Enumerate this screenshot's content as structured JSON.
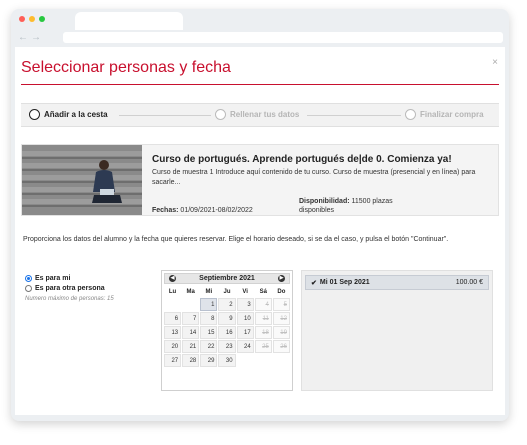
{
  "modal": {
    "title": "Seleccionar personas y fecha",
    "close": "×"
  },
  "steps": [
    {
      "label": "Añadir a la cesta",
      "state": "active"
    },
    {
      "label": "Rellenar tus datos",
      "state": "inactive"
    },
    {
      "label": "Finalizar compra",
      "state": "inactive"
    }
  ],
  "course": {
    "title": "Curso de portugués. Aprende portugués de|de 0. Comienza ya!",
    "description": "Curso de muestra 1  Introduce aquí contenido de tu curso. Curso de muestra (presencial y en línea) para sacarle...",
    "dates_label": "Fechas:",
    "dates_value": "01/09/2021-08/02/2022",
    "availability_label": "Disponibilidad:",
    "availability_value": "11500 plazas",
    "availability_value2": "disponibles"
  },
  "instructions": "Proporciona los datos del alumno y la fecha que quieres reservar. Elige el horario deseado, si se da el caso, y pulsa el botón \"Continuar\".",
  "booking": {
    "options": [
      {
        "label": "Es para mi",
        "checked": true
      },
      {
        "label": "Es para otra persona",
        "checked": false
      }
    ],
    "max_note": "Numero máximo de personas: 15"
  },
  "calendar": {
    "month": "Septiembre 2021",
    "prev_icon": "chevron-left-icon",
    "next_icon": "chevron-right-icon",
    "weekdays": [
      "Lu",
      "Ma",
      "Mi",
      "Ju",
      "Vi",
      "Sá",
      "Do"
    ],
    "weeks": [
      [
        "",
        "",
        "1",
        "2",
        "3",
        "4",
        "5"
      ],
      [
        "6",
        "7",
        "8",
        "9",
        "10",
        "11",
        "12"
      ],
      [
        "13",
        "14",
        "15",
        "16",
        "17",
        "18",
        "19"
      ],
      [
        "20",
        "21",
        "22",
        "23",
        "24",
        "25",
        "26"
      ],
      [
        "27",
        "28",
        "29",
        "30",
        "",
        "",
        ""
      ]
    ],
    "selected": "1"
  },
  "slots": [
    {
      "date": "Mi 01 Sep 2021",
      "price": "100.00 €",
      "selected": true
    }
  ],
  "colors": {
    "accent": "#c8102e",
    "radio": "#1a73e8"
  }
}
